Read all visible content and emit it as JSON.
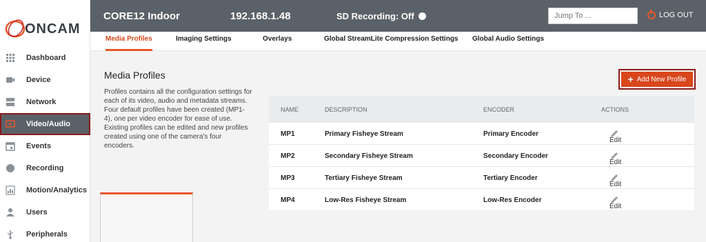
{
  "brand": {
    "logo_text": "ONCAM",
    "accent": "#e8562a"
  },
  "topbar": {
    "device_name": "CORE12 Indoor",
    "ip": "192.168.1.48",
    "sd_recording": "SD Recording: Off",
    "jump_placeholder": "Jump To ...",
    "logout": "LOG OUT"
  },
  "sidebar": {
    "items": [
      {
        "label": "Dashboard",
        "icon": "dashboard-icon"
      },
      {
        "label": "Device",
        "icon": "device-icon"
      },
      {
        "label": "Network",
        "icon": "network-icon"
      },
      {
        "label": "Video/Audio",
        "icon": "video-icon",
        "active": true
      },
      {
        "label": "Events",
        "icon": "events-icon"
      },
      {
        "label": "Recording",
        "icon": "recording-icon"
      },
      {
        "label": "Motion/Analytics",
        "icon": "analytics-icon"
      },
      {
        "label": "Users",
        "icon": "users-icon"
      },
      {
        "label": "Peripherals",
        "icon": "usb-icon"
      }
    ]
  },
  "tabs": [
    {
      "label": "Media Profiles",
      "active": true
    },
    {
      "label": "Imaging Settings"
    },
    {
      "label": "Overlays"
    },
    {
      "label": "Global StreamLite Compression Settings"
    },
    {
      "label": "Global Audio Settings"
    }
  ],
  "main": {
    "title": "Media Profiles",
    "description": "Profiles contains all the configuration settings for each of its video, audio and metadata streams. Four default profiles have been created (MP1-4), one per video encoder for ease of use. Existing profiles can be edited and new profiles created using one of the camera's four encoders.",
    "add_button": "Add New Profile"
  },
  "table": {
    "headers": {
      "name": "NAME",
      "description": "DESCRIPTION",
      "encoder": "ENCODER",
      "actions": "ACTIONS"
    },
    "rows": [
      {
        "name": "MP1",
        "description": "Primary Fisheye Stream",
        "encoder": "Primary Encoder",
        "action": "Edit"
      },
      {
        "name": "MP2",
        "description": "Secondary Fisheye Stream",
        "encoder": "Secondary Encoder",
        "action": "Edit"
      },
      {
        "name": "MP3",
        "description": "Tertiary Fisheye Stream",
        "encoder": "Tertiary Encoder",
        "action": "Edit"
      },
      {
        "name": "MP4",
        "description": "Low-Res Fisheye Stream",
        "encoder": "Low-Res Encoder",
        "action": "Edit"
      }
    ]
  }
}
